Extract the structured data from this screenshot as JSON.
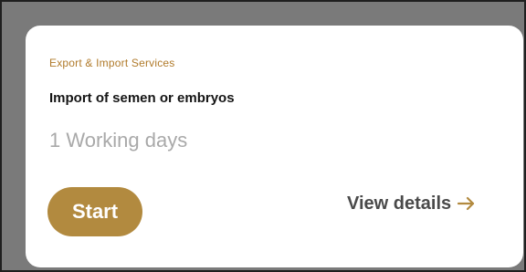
{
  "card": {
    "category": "Export & Import Services",
    "title": "Import of semen or embryos",
    "duration": "1 Working days",
    "start_label": "Start",
    "details_label": "View details",
    "details_icon": "right-arrow-icon",
    "accent_color": "#b28a3f"
  }
}
